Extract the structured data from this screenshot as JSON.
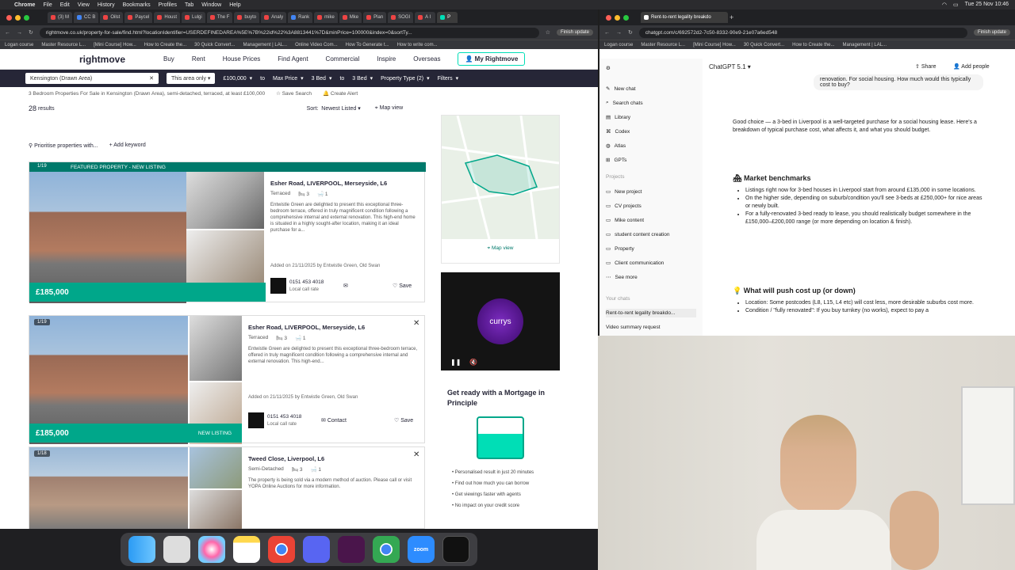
{
  "menubar": {
    "apple": "",
    "app": "Chrome",
    "items": [
      "File",
      "Edit",
      "View",
      "History",
      "Bookmarks",
      "Profiles",
      "Tab",
      "Window",
      "Help"
    ],
    "clock": "Tue 25 Nov 10:46"
  },
  "left_browser": {
    "tabs": [
      "(3) M",
      "CC B",
      "Oilst",
      "Paycel",
      "Houst",
      "Lulgi",
      "The F",
      "buyto",
      "Analy",
      "Rank",
      "mike",
      "Mke",
      "Plan",
      "SOGI",
      "A I",
      "P"
    ],
    "url": "rightmove.co.uk/property-for-sale/find.html?locationIdentifier=USERDEFINEDAREA%5E%7B%22id%22%3A8813441%7D&minPrice=100000&index=0&sortTy...",
    "finish_update": "Finish update",
    "bookmarks": [
      "Logan course",
      "Master Resource L...",
      "[Mini Course] How...",
      "How to Create the...",
      "30 Quick Convert...",
      "Management | LAL...",
      "Online Video Com...",
      "How To Generate t...",
      "How to write com..."
    ]
  },
  "rightmove": {
    "logo": "rightmove",
    "nav": [
      "Buy",
      "Rent",
      "House Prices",
      "Find Agent",
      "Commercial",
      "Inspire",
      "Overseas"
    ],
    "my_rightmove": "My Rightmove",
    "filters": {
      "location": "Kensington (Drawn Area)",
      "radius": "This area only",
      "min_price": "£100,000",
      "to1": "to",
      "max_price": "Max Price",
      "min_beds": "3 Bed",
      "to2": "to",
      "max_beds": "3 Bed",
      "type": "Property Type (2)",
      "more": "Filters"
    },
    "subtitle": "3 Bedroom Properties For Sale in Kensington (Drawn Area), semi-detached, terraced, at least £100,000",
    "save_search": "Save Search",
    "create_alert": "Create Alert",
    "results_count": "28",
    "results_label": "results",
    "sort_label": "Sort:",
    "sort_value": "Newest Listed",
    "map_view": "Map view",
    "prioritise": "Prioritise properties with...",
    "add_keyword": "Add keyword",
    "listings": [
      {
        "featured": "FEATURED PROPERTY - NEW LISTING",
        "photos": "1/19",
        "address": "Esher Road, LIVERPOOL, Merseyside, L6",
        "type": "Terraced",
        "beds": "3",
        "baths": "1",
        "desc": "Entwistle Green are delighted to present this exceptional three-bedroom terrace, offered in truly magnificent condition following a comprehensive internal and external renovation. This high-end home is situated in a highly sought-after location, making it an ideal purchase for a...",
        "added": "Added on 21/11/2025 by Entwistle Green, Old Swan",
        "phone": "0151 453 4018",
        "rate": "Local call rate",
        "save": "Save",
        "price": "£185,000"
      },
      {
        "photos": "1/19",
        "address": "Esher Road, LIVERPOOL, Merseyside, L6",
        "type": "Terraced",
        "beds": "3",
        "baths": "1",
        "desc": "Entwistle Green are delighted to present this exceptional three-bedroom terrace, offered in truly magnificent condition following a comprehensive internal and external renovation. This high-end...",
        "added": "Added on 21/11/2025 by Entwistle Green, Old Swan",
        "phone": "0151 453 4018",
        "rate": "Local call rate",
        "contact": "Contact",
        "save": "Save",
        "price": "£185,000",
        "new_listing": "NEW LISTING"
      },
      {
        "photos": "1/18",
        "address": "Tweed Close, Liverpool, L6",
        "type": "Semi-Detached",
        "beds": "3",
        "baths": "1",
        "desc": "The property is being sold via a modern method of auction. Please call or visit YOPA Online Auctions for more information."
      }
    ],
    "map_view_link": "Map view",
    "ad_brand": "currys",
    "mortgage": {
      "title": "Get ready with a Mortgage in Principle",
      "bullets": [
        "Personalised result in just 20 minutes",
        "Find out how much you can borrow",
        "Get viewings faster with agents",
        "No impact on your credit score"
      ]
    }
  },
  "right_browser": {
    "tab_title": "Rent-to-rent legality breakdo",
    "url": "chatgpt.com/c/692572d2-7c50-8332-90e9-21e07a6ed548",
    "finish_update": "Finish update",
    "bookmarks": [
      "Logan course",
      "Master Resource L...",
      "[Mini Course] How...",
      "30 Quick Convert...",
      "How to Create the...",
      "Management | LAL..."
    ]
  },
  "chatgpt": {
    "model": "ChatGPT 5.1",
    "share": "Share",
    "add_people": "Add people",
    "sidebar": [
      "New chat",
      "Search chats",
      "Library",
      "Codex",
      "Atlas",
      "GPTs"
    ],
    "projects_label": "Projects",
    "projects": [
      "New project",
      "CV projects",
      "Mike content",
      "student content creation",
      "Property",
      "Client communication",
      "See more"
    ],
    "chats_label": "Your chats",
    "chats": [
      "Rent-to-rent legality breakdo...",
      "Video summary request"
    ],
    "user_msg": "renovation. For social housing. How much would this typically cost to buy?",
    "intro": "Good choice — a 3-bed in Liverpool is a well-targeted purchase for a social housing lease. Here's a breakdown of typical purchase cost, what affects it, and what you should budget.",
    "h1": "Market benchmarks",
    "bullets1": [
      "Listings right now for 3-bed houses in Liverpool start from around £135,000 in some locations.",
      "On the higher side, depending on suburb/condition you'll see 3-beds at £250,000+ for nice areas or newly built.",
      "For a fully-renovated 3-bed ready to lease, you should realistically budget somewhere in the £150,000–£200,000 range (or more depending on location & finish)."
    ],
    "h2": "What will push cost up (or down)",
    "bullets2": [
      "Location: Some postcodes (L8, L15, L4 etc) will cost less, more desirable suburbs cost more.",
      "Condition / \"fully renovated\": If you buy turnkey (no works), expect to pay a"
    ]
  },
  "dock": {
    "apps": [
      "Finder",
      "Launchpad",
      "Photos",
      "Notes",
      "Chrome",
      "Discord",
      "Slack",
      "Chrome",
      "Zoom",
      "Activity"
    ]
  }
}
